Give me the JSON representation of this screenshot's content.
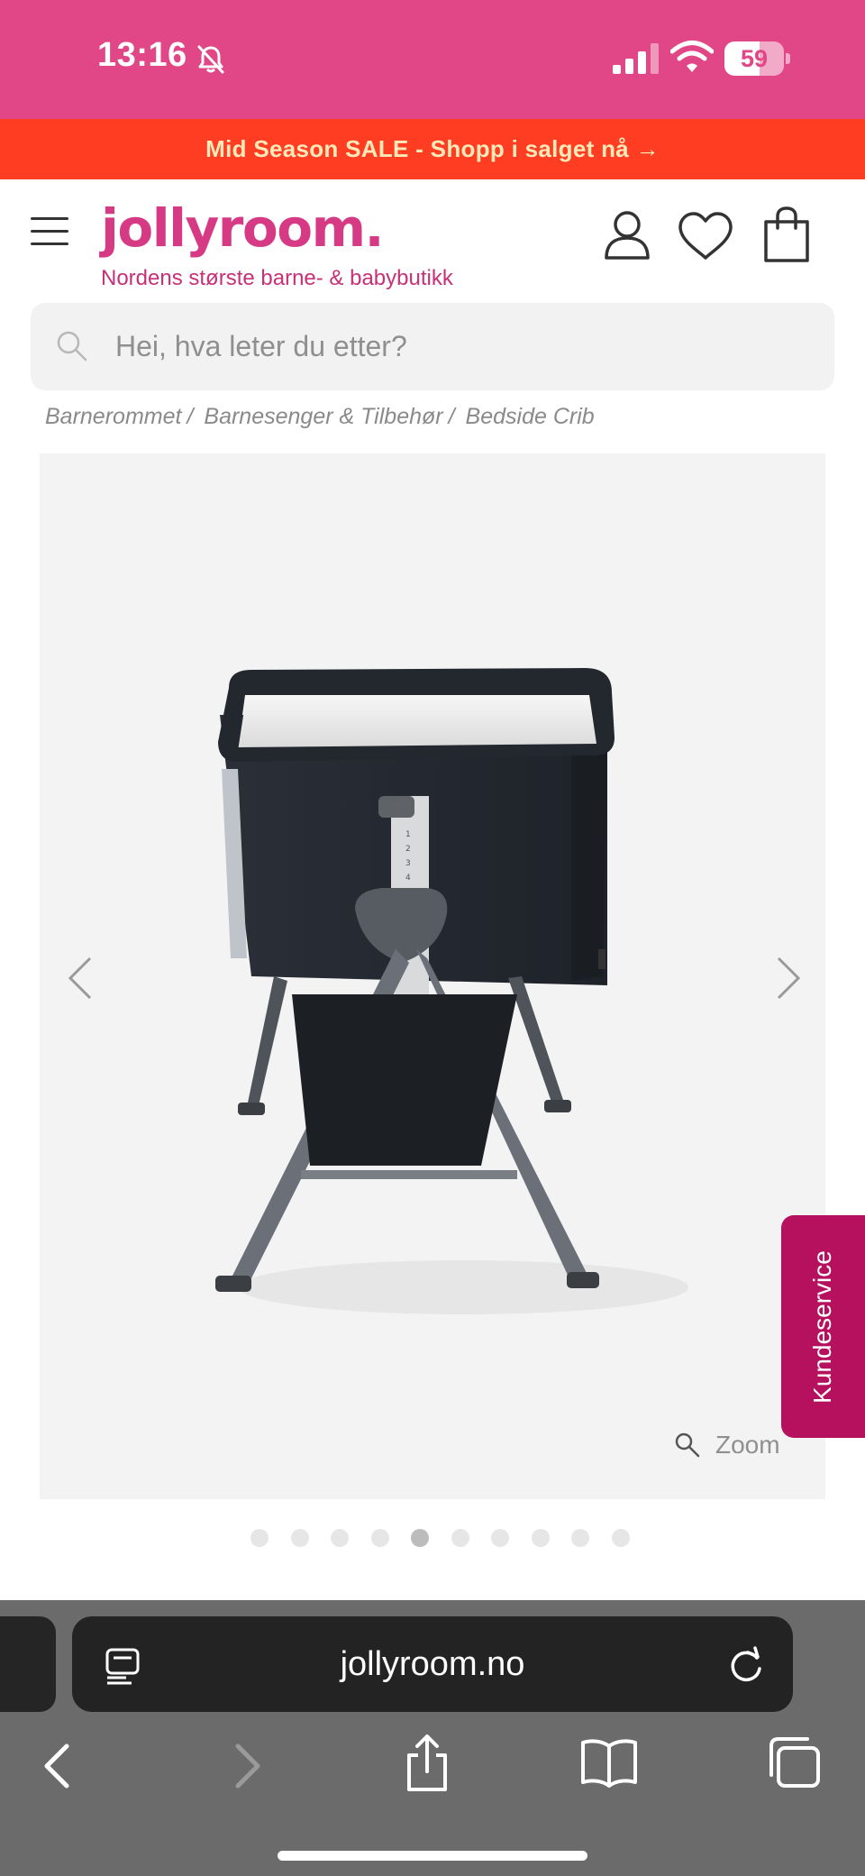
{
  "status_bar": {
    "time": "13:16",
    "battery_level": "59",
    "battery_fraction": 0.59
  },
  "promo": {
    "text": "Mid Season SALE - Shopp i salget nå →"
  },
  "header": {
    "logo": "jollyroom.",
    "tagline": "Nordens største barne- & babybutikk"
  },
  "search": {
    "placeholder": "Hei, hva leter du etter?"
  },
  "breadcrumb": [
    "Barnerommet",
    "Barnesenger & Tilbehør",
    "Bedside Crib"
  ],
  "breadcrumb_separator": "/",
  "gallery": {
    "zoom_label": "Zoom",
    "image_count": 10,
    "active_index": 4
  },
  "floating": {
    "customer_service": "Kundeservice"
  },
  "browser": {
    "url": "jollyroom.no"
  },
  "colors": {
    "status_bar": "#e14686",
    "promo_bg": "#ff3d22",
    "promo_text": "#ffe9b8",
    "brand_pink": "#d63a84",
    "customer_service_bg": "#b5115e",
    "safari_bar": "#6b6b6b"
  },
  "icons": {
    "status": [
      "bell-slash-icon",
      "signal-icon",
      "wifi-icon",
      "battery-icon"
    ],
    "header": [
      "menu-icon",
      "account-icon",
      "wishlist-icon",
      "cart-icon"
    ],
    "search": "search-icon",
    "gallery": [
      "chevron-left-icon",
      "chevron-right-icon",
      "zoom-icon"
    ],
    "browser": [
      "reader-icon",
      "reload-icon",
      "back-icon",
      "forward-icon",
      "share-icon",
      "bookmarks-icon",
      "tabs-icon"
    ]
  }
}
